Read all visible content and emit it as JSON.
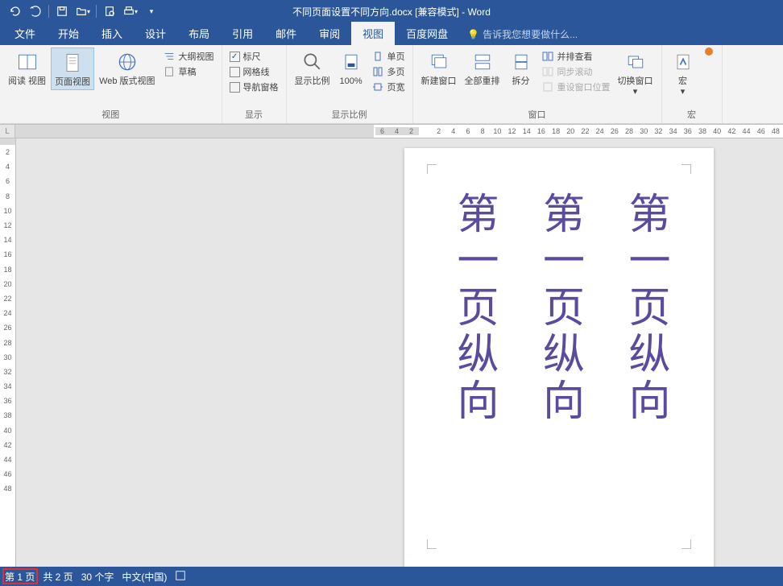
{
  "title": "不同页面设置不同方向.docx [兼容模式] - Word",
  "tabs": {
    "file": "文件",
    "home": "开始",
    "insert": "插入",
    "design": "设计",
    "layout": "布局",
    "references": "引用",
    "mail": "邮件",
    "review": "审阅",
    "view": "视图",
    "baidu": "百度网盘",
    "tellme": "告诉我您想要做什么..."
  },
  "ribbon": {
    "views": {
      "label": "视图",
      "read": "阅读\n视图",
      "page": "页面视图",
      "web": "Web 版式视图",
      "outline": "大纲视图",
      "draft": "草稿"
    },
    "show": {
      "label": "显示",
      "ruler": "标尺",
      "grid": "网格线",
      "nav": "导航窗格"
    },
    "zoom": {
      "label": "显示比例",
      "zoom": "显示比例",
      "hundred": "100%",
      "one": "单页",
      "multi": "多页",
      "width": "页宽"
    },
    "window": {
      "label": "窗口",
      "new": "新建窗口",
      "all": "全部重排",
      "split": "拆分",
      "side": "并排查看",
      "sync": "同步滚动",
      "reset": "重设窗口位置",
      "switch": "切换窗口"
    },
    "macros": {
      "label": "宏",
      "macro": "宏"
    }
  },
  "ruler_h_left": [
    "6",
    "4",
    "2"
  ],
  "ruler_h_right": [
    "2",
    "4",
    "6",
    "8",
    "10",
    "12",
    "14",
    "16",
    "18",
    "20",
    "22",
    "24",
    "26",
    "28",
    "30",
    "32",
    "34",
    "36",
    "38",
    "40",
    "42",
    "44",
    "46",
    "48"
  ],
  "ruler_v": [
    "2",
    "4",
    "6",
    "8",
    "10",
    "12",
    "14",
    "16",
    "18",
    "20",
    "22",
    "24",
    "26",
    "28",
    "30",
    "32",
    "34",
    "36",
    "38",
    "40",
    "42",
    "44",
    "46",
    "48"
  ],
  "doc_text": "第一页纵向",
  "status": {
    "page": "第 1 页",
    "pages": "共 2 页",
    "words": "30 个字",
    "lang": "中文(中国)"
  }
}
